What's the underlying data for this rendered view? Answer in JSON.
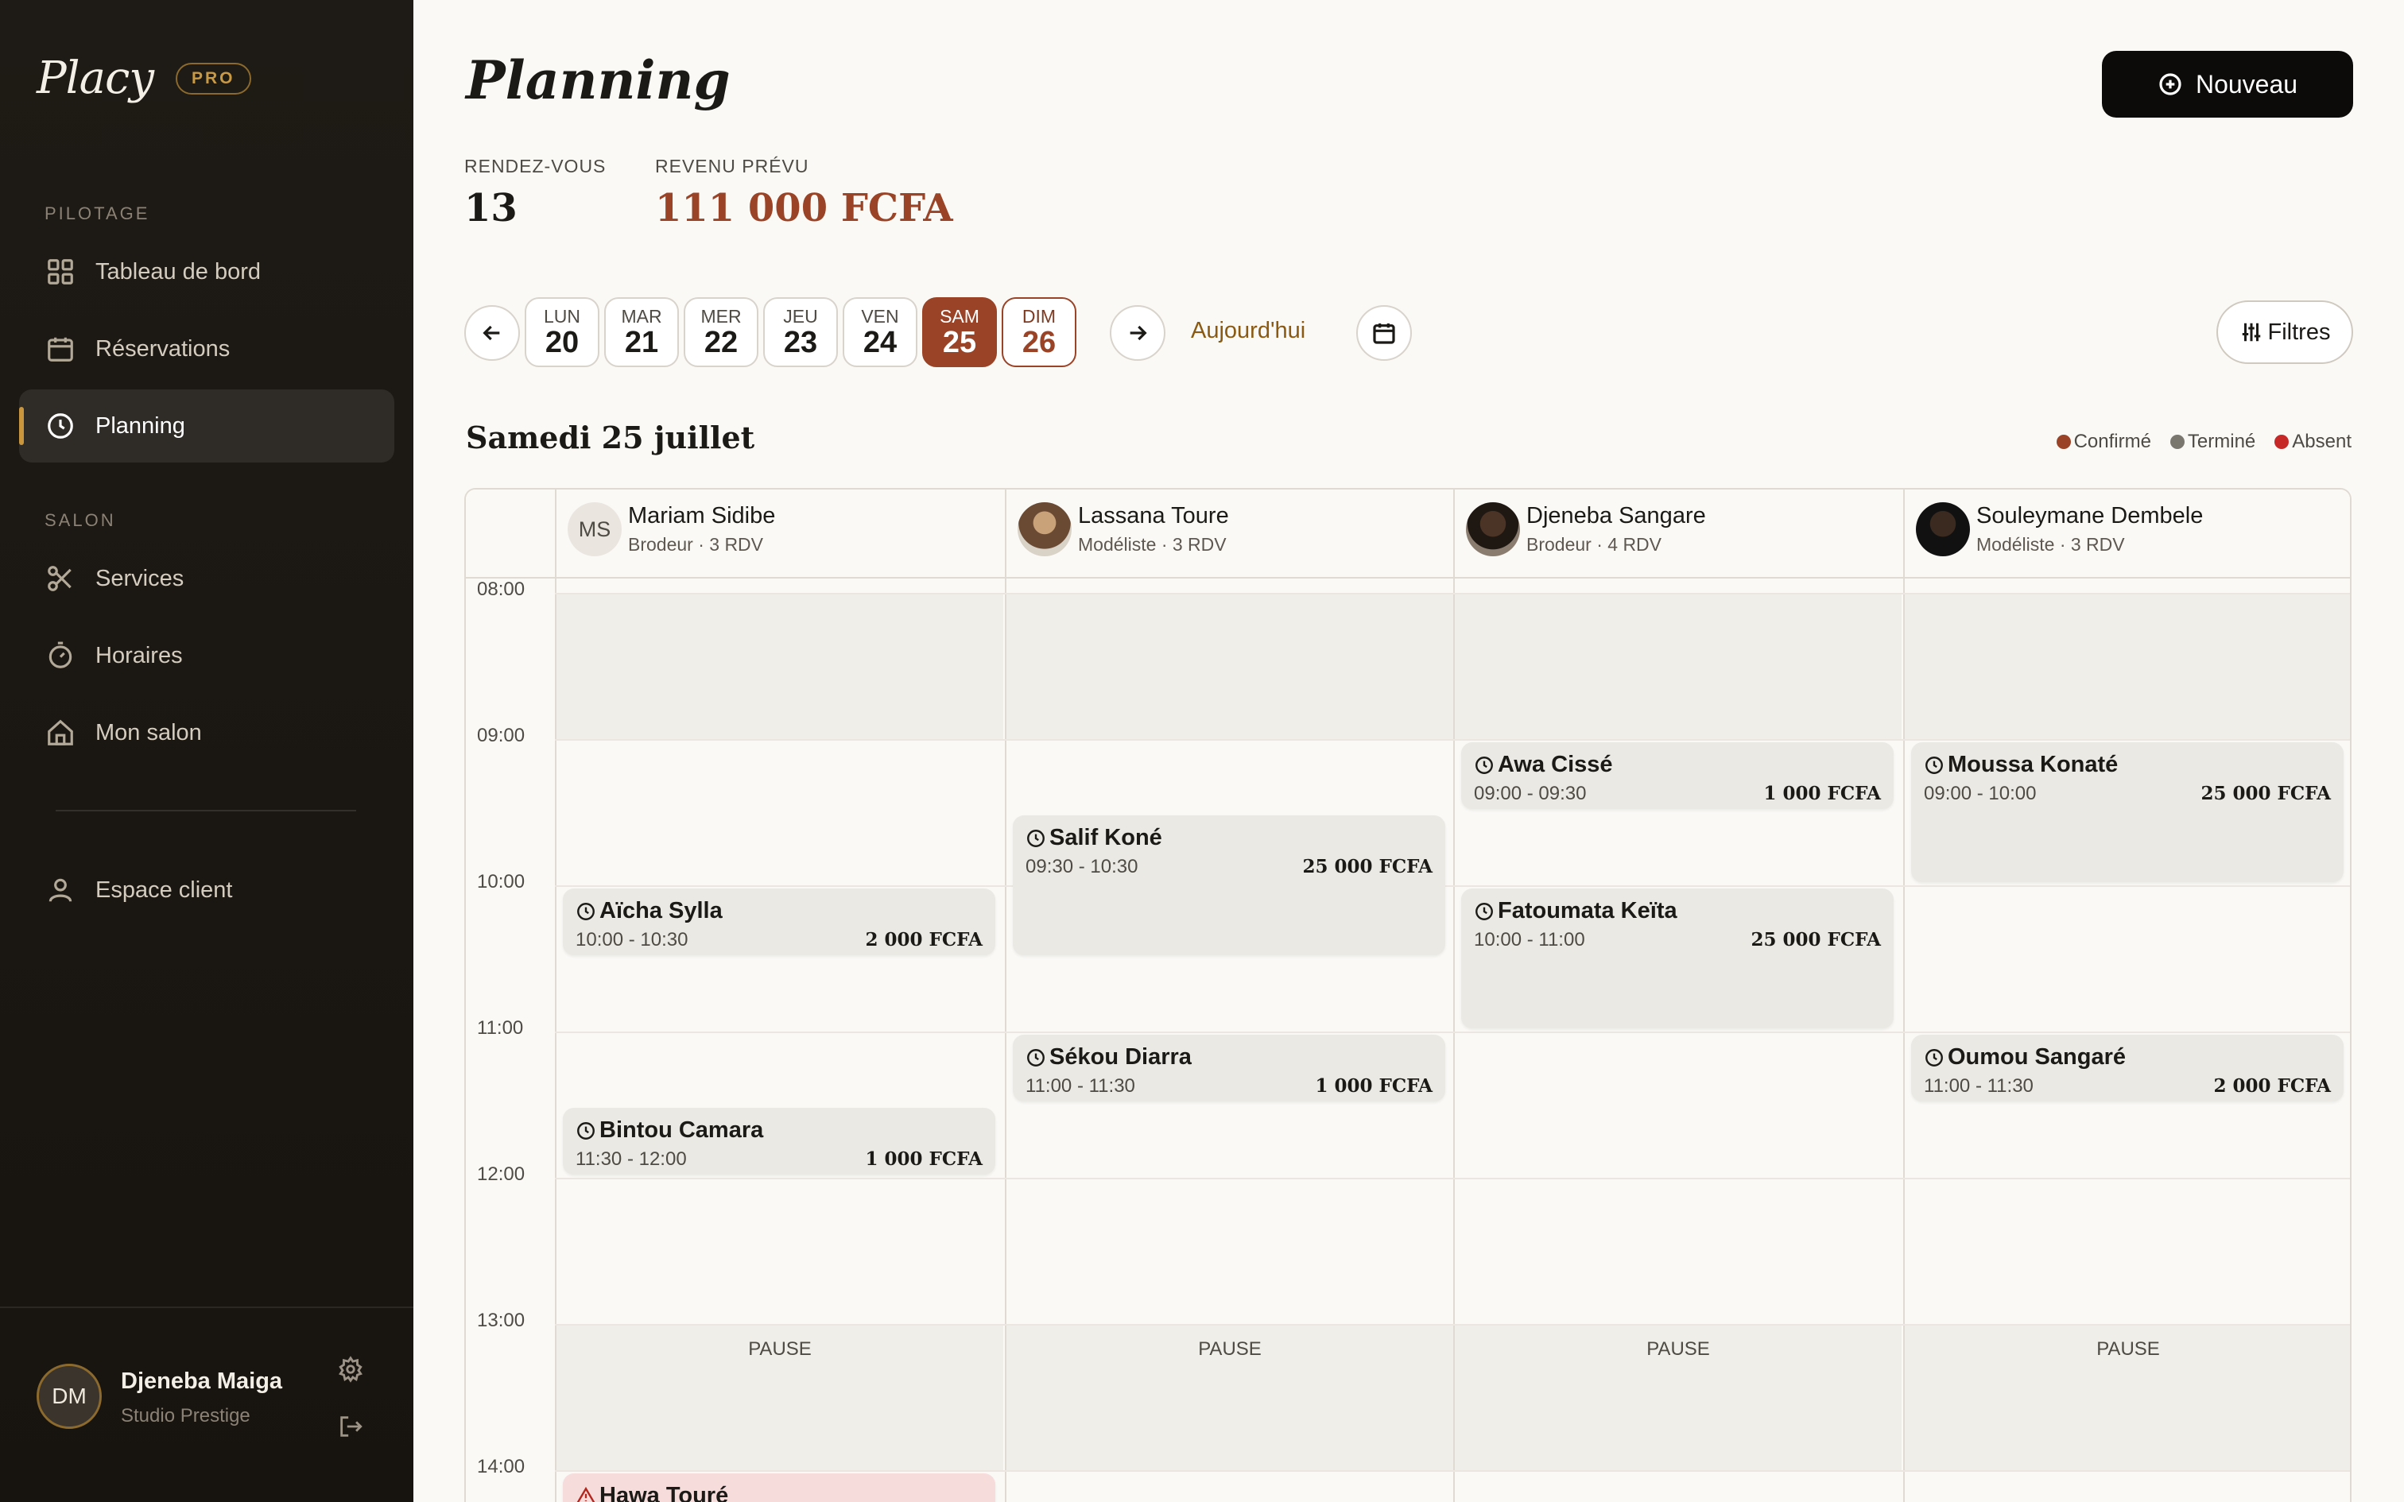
{
  "sidebar": {
    "brand": "Placy",
    "badge": "PRO",
    "sections": {
      "pilotage": "PILOTAGE",
      "salon": "SALON"
    },
    "items": [
      {
        "label": "Tableau de bord",
        "icon": "grid-icon"
      },
      {
        "label": "Réservations",
        "icon": "calendar-icon"
      },
      {
        "label": "Planning",
        "icon": "clock-icon",
        "active": true
      },
      {
        "label": "Services",
        "icon": "scissors-icon"
      },
      {
        "label": "Horaires",
        "icon": "timer-icon"
      },
      {
        "label": "Mon salon",
        "icon": "home-icon"
      },
      {
        "label": "Espace client",
        "icon": "user-icon"
      }
    ],
    "user": {
      "initials": "DM",
      "name": "Djeneba Maiga",
      "salon": "Studio Prestige"
    }
  },
  "header": {
    "title": "Planning",
    "new_button": "Nouveau",
    "stats": {
      "rdv_label": "RENDEZ-VOUS",
      "rdv_value": "13",
      "revenue_label": "REVENU PRÉVU",
      "revenue_value": "111 000 FCFA"
    },
    "colors": {
      "revenue": "#9b4326",
      "accent": "#c9963e"
    }
  },
  "daybar": {
    "days": [
      {
        "name": "LUN",
        "num": "20"
      },
      {
        "name": "MAR",
        "num": "21"
      },
      {
        "name": "MER",
        "num": "22"
      },
      {
        "name": "JEU",
        "num": "23"
      },
      {
        "name": "VEN",
        "num": "24"
      },
      {
        "name": "SAM",
        "num": "25",
        "selected": true
      },
      {
        "name": "DIM",
        "num": "26",
        "today": true
      }
    ],
    "today_label": "Aujourd'hui",
    "filters_label": "Filtres"
  },
  "schedule": {
    "date_heading": "Samedi 25 juillet",
    "legend": [
      {
        "label": "Confirmé",
        "color": "#9b4326"
      },
      {
        "label": "Terminé",
        "color": "#7a776f"
      },
      {
        "label": "Absent",
        "color": "#c62828"
      }
    ],
    "hours": [
      "08:00",
      "09:00",
      "10:00",
      "11:00",
      "12:00",
      "13:00",
      "14:00"
    ],
    "pause_label": "PAUSE",
    "staff": [
      {
        "name": "Mariam Sidibe",
        "role": "Brodeur · 3 RDV",
        "initials": "MS"
      },
      {
        "name": "Lassana Toure",
        "role": "Modéliste · 3 RDV",
        "initials": ""
      },
      {
        "name": "Djeneba Sangare",
        "role": "Brodeur · 4 RDV",
        "initials": ""
      },
      {
        "name": "Souleymane Dembele",
        "role": "Modéliste · 3 RDV",
        "initials": ""
      }
    ],
    "appointments": [
      {
        "name": "Aïcha Sylla",
        "time": "10:00 - 10:30",
        "price": "2 000 FCFA",
        "status": "confirmed"
      },
      {
        "name": "Bintou Camara",
        "time": "11:30 - 12:00",
        "price": "1 000 FCFA",
        "status": "confirmed"
      },
      {
        "name": "Hawa Touré",
        "status": "absent"
      },
      {
        "name": "Salif Koné",
        "time": "09:30 - 10:30",
        "price": "25 000 FCFA",
        "status": "confirmed"
      },
      {
        "name": "Sékou Diarra",
        "time": "11:00 - 11:30",
        "price": "1 000 FCFA",
        "status": "confirmed"
      },
      {
        "name": "Awa Cissé",
        "time": "09:00 - 09:30",
        "price": "1 000 FCFA",
        "status": "confirmed"
      },
      {
        "name": "Fatoumata Keïta",
        "time": "10:00 - 11:00",
        "price": "25 000 FCFA",
        "status": "confirmed"
      },
      {
        "name": "Moussa Konaté",
        "time": "09:00 - 10:00",
        "price": "25 000 FCFA",
        "status": "confirmed"
      },
      {
        "name": "Oumou Sangaré",
        "time": "11:00 - 11:30",
        "price": "2 000 FCFA",
        "status": "confirmed"
      }
    ]
  }
}
